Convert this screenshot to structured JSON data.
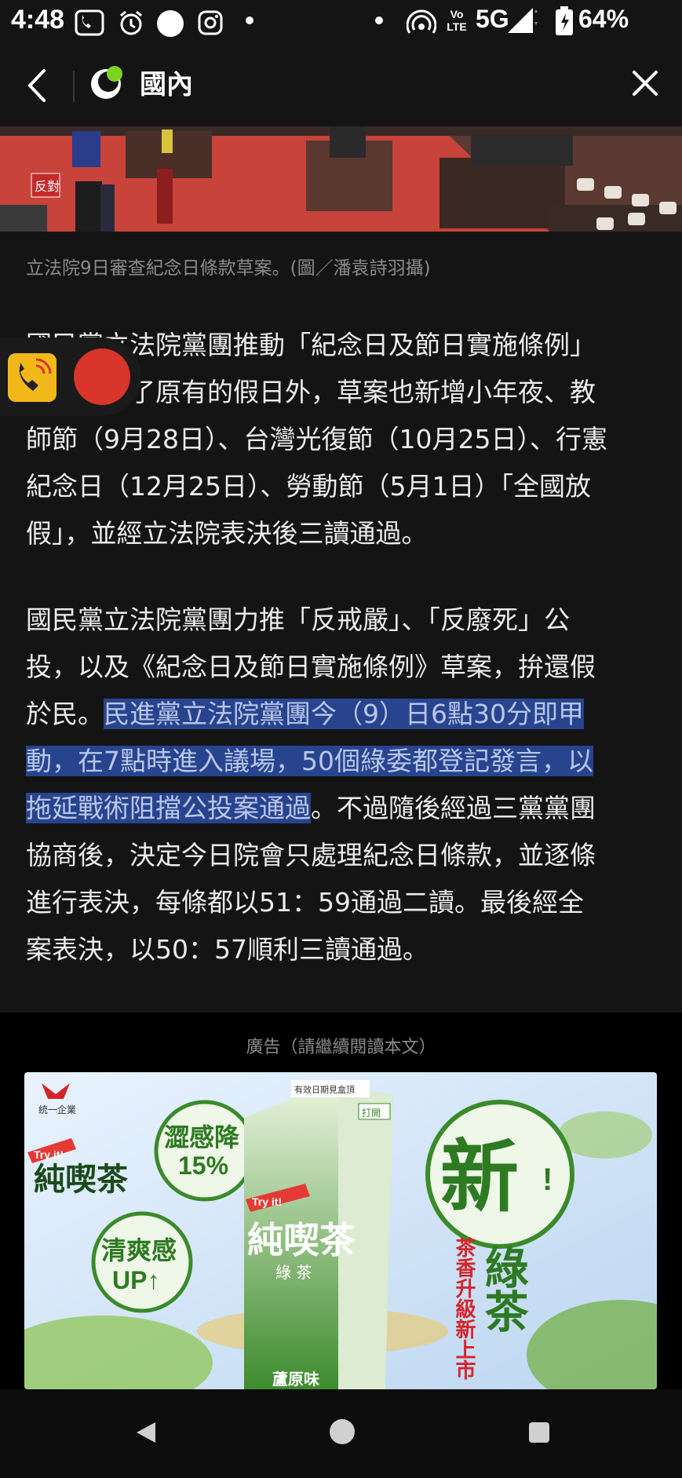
{
  "status_bar": {
    "time": "4:48",
    "network": "5G",
    "volte": "Vo LTE",
    "battery": "64%",
    "icons": [
      "voicemail-icon",
      "alarm-icon",
      "circle-icon",
      "instagram-icon",
      "dot-icon",
      "hotspot-icon",
      "volte-icon",
      "signal-icon",
      "battery-icon"
    ]
  },
  "nav": {
    "title": "國內",
    "back_icon": "chevron-left-icon",
    "close_icon": "close-icon",
    "brand_color": "#7ed321"
  },
  "article": {
    "image_caption": "立法院9日審查紀念日條款草案。(圖／潘袁詩羽攝)",
    "hero_texts": [
      "反對"
    ],
    "p1_lines": [
      "國民黨立法院黨團推動「紀念日及節日實施條例」",
      "草案，除了原有的假日外，草案也新增小年夜、教",
      "師節（9月28日）、台灣光復節（10月25日）、行憲",
      "紀念日（12月25日）、勞動節（5月1日）「全國放",
      "假」，並經立法院表決後三讀通過。"
    ],
    "p2": {
      "line1": "國民黨立法院黨團力推「反戒嚴」、「反廢死」公",
      "line2": "投，以及《紀念日及節日實施條例》草案，拚還假",
      "line3_plain": "於民。",
      "line3_hl": "民進黨立法院黨團今（9）日6點30分即甲",
      "line4_hl": "動，在7點時進入議場，50個綠委都登記發言，以",
      "line5_hl": "拖延戰術阻擋公投案通過",
      "line5_plain": "。不過隨後經過三黨黨團",
      "line6": "協商後，決定今日院會只處理紀念日條款，並逐條",
      "line7": "進行表決，每條都以51：59通過二讀。最後經全",
      "line8": "案表決，以50：57順利三讀通過。"
    },
    "highlight_color": "#28448f"
  },
  "floating_widget": {
    "icons": [
      "phone-call-icon",
      "record-icon"
    ]
  },
  "ad": {
    "label": "廣告（請繼續閱讀本文）",
    "brand_logo_text": "統一企業",
    "product_name": "純喫茶",
    "product_sub": "綠 茶",
    "tryit": "Try it!",
    "badge1_line1": "澀感降",
    "badge1_line2": "15%",
    "badge2_line1": "清爽感",
    "badge2_line2": "UP↑",
    "new_char": "新",
    "new_excl": "!",
    "green_tea": "綠茶",
    "slogan": "茶香升級新上市",
    "carton_top": "有效日期見盒頂",
    "carton_open": "打開",
    "carton_bottom": "蘆原味"
  },
  "system_nav": {
    "icons": [
      "back-triangle-icon",
      "home-circle-icon",
      "recents-square-icon"
    ]
  }
}
